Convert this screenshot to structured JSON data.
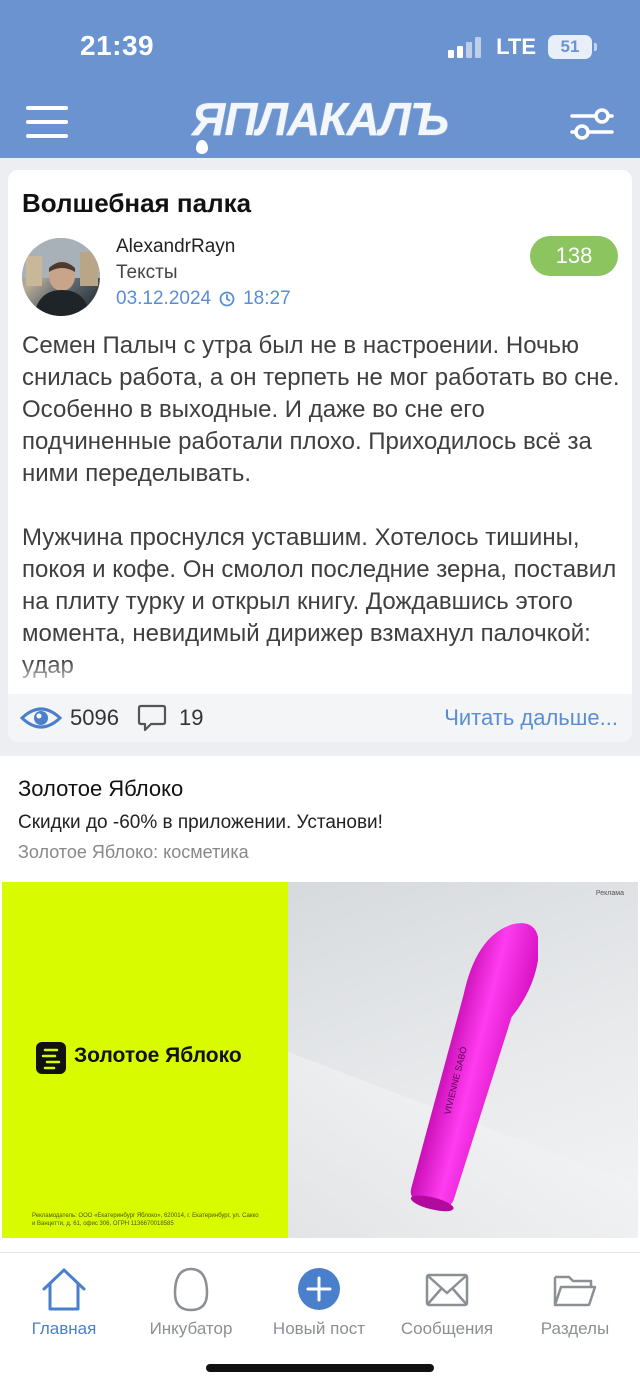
{
  "status_bar": {
    "time": "21:39",
    "network": "LTE",
    "battery": "51"
  },
  "header": {
    "logo": "ЯПЛАКАЛЪ"
  },
  "post": {
    "title": "Волшебная палка",
    "author": "AlexandrRayn",
    "category": "Тексты",
    "date": "03.12.2024",
    "time": "18:27",
    "score": "138",
    "paragraphs": [
      "Семен Палыч с утра был не в настроении. Ночью снилась работа, а он терпеть не мог работать во сне. Особенно в выходные. И даже во сне его подчиненные работали плохо. Приходилось всё за ними переделывать.",
      "Мужчина проснулся уставшим. Хотелось тишины, покоя и кофе. Он смолол последние зерна, поставил на плиту турку и открыл книгу. Дождавшись этого момента, невидимый дирижер взмахнул палочкой: удар"
    ],
    "views": "5096",
    "comments": "19",
    "read_more": "Читать дальше..."
  },
  "ad": {
    "title": "Золотое Яблоко",
    "subtitle": "Скидки до -60% в приложении. Установи!",
    "source": "Золотое Яблоко: косметика",
    "banner_logo": "Золотое Яблоко",
    "banner_tag": "Реклама",
    "fineprint": "Рекламодатель: ООО «Екатеринбург Яблоко», 620014, г. Екатеринбург, ул. Сакко и Ванцетти, д. 61, офис 306, ОГРН 1136670018585",
    "product_brand": "VIVIENNE SABÓ",
    "brand_color": "#d8fb00",
    "product_color": "#f81ae0"
  },
  "tabs": [
    {
      "label": "Главная",
      "icon": "home-icon",
      "active": true
    },
    {
      "label": "Инкубатор",
      "icon": "egg-icon",
      "active": false
    },
    {
      "label": "Новый пост",
      "icon": "plus-circle-icon",
      "active": false
    },
    {
      "label": "Сообщения",
      "icon": "envelope-icon",
      "active": false
    },
    {
      "label": "Разделы",
      "icon": "folder-icon",
      "active": false
    }
  ],
  "colors": {
    "header": "#6a93cf",
    "accent": "#5a8dd6",
    "score_badge": "#8cc560"
  }
}
